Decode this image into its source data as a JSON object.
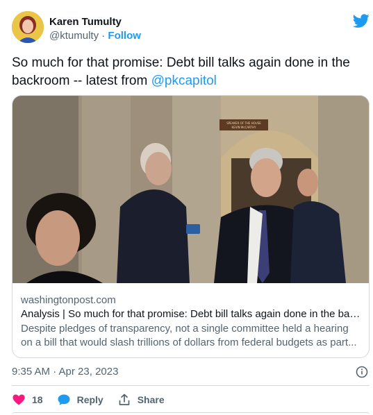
{
  "author": {
    "display_name": "Karen Tumulty",
    "handle": "@ktumulty",
    "separator": "·",
    "follow_label": "Follow"
  },
  "tweet": {
    "text_main": "So much for that promise: Debt bill talks again done in the backroom -- latest from ",
    "mention": "@pkcapitol"
  },
  "card": {
    "photo_sign": "SPEAKER OF THE HOUSE KEVIN McCARTHY",
    "domain": "washingtonpost.com",
    "title": "Analysis | So much for that promise: Debt bill talks again done in the bac...",
    "desc_line1": "Despite pledges of transparency, not a single committee held a hearing",
    "desc_line2": "on a bill that would slash trillions of dollars from federal budgets as part..."
  },
  "meta": {
    "timestamp": "9:35 AM · Apr 23, 2023"
  },
  "actions": {
    "like_count": "18",
    "reply_label": "Reply",
    "share_label": "Share"
  },
  "colors": {
    "accent": "#1d9bf0",
    "like": "#f91880",
    "text": "#0f1419",
    "secondary": "#536471",
    "border": "#cfd9de"
  },
  "icons": [
    "twitter-bird-icon",
    "info-icon",
    "heart-icon",
    "reply-bubble-icon",
    "share-icon"
  ]
}
